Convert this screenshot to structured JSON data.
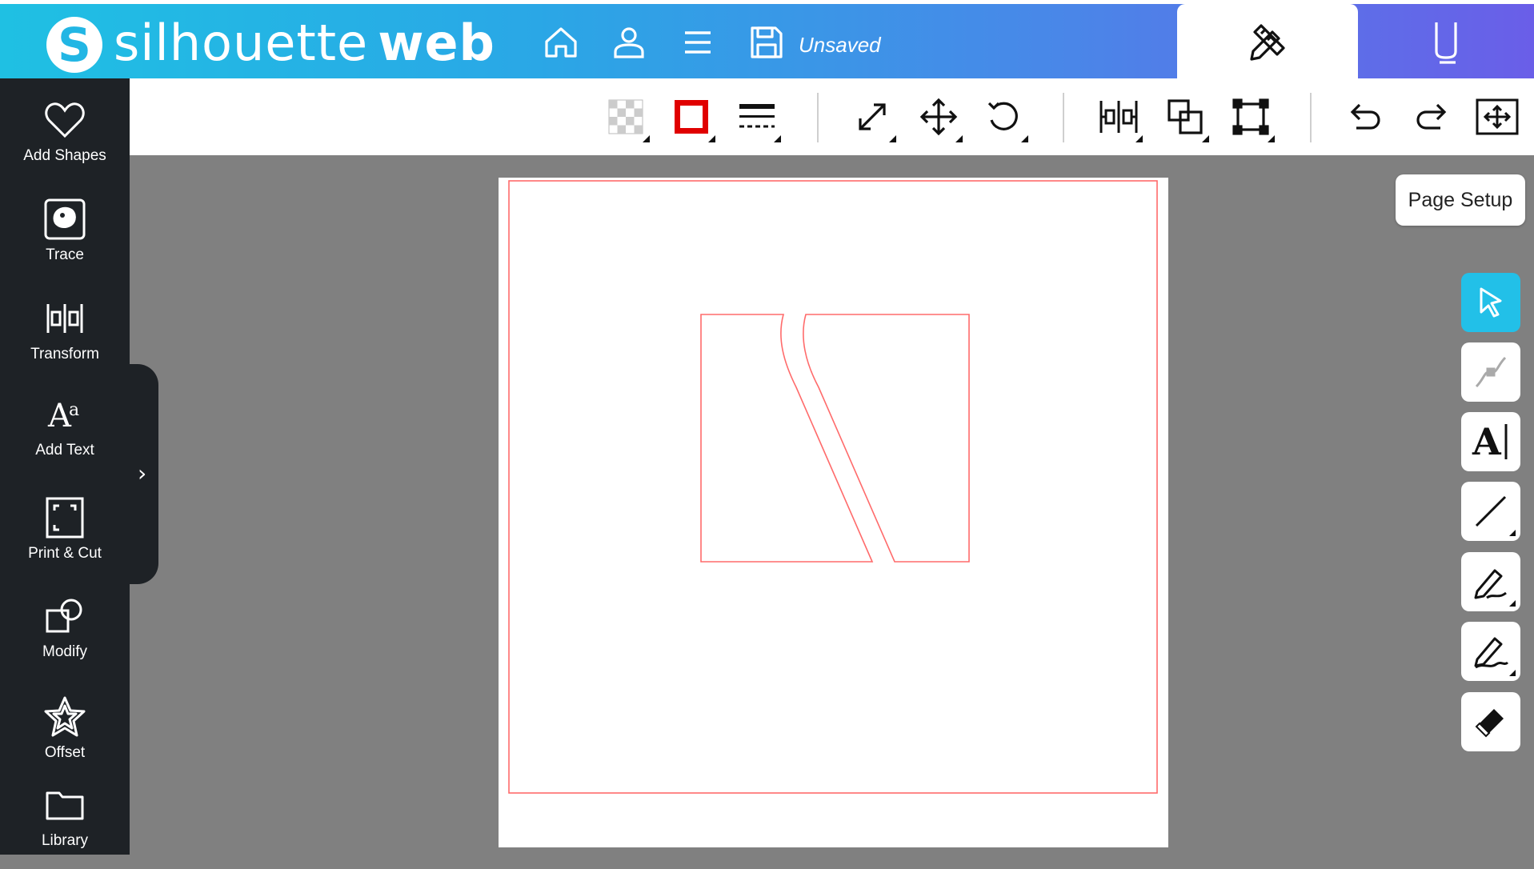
{
  "header": {
    "logo_letter": "S",
    "logo_light": "silhouette",
    "logo_bold": "web",
    "save_status": "Unsaved",
    "icons": [
      "home-icon",
      "user-icon",
      "menu-icon",
      "save-icon"
    ],
    "tabs": [
      {
        "name": "design-tab",
        "icon": "pencil-ruler-icon",
        "active": true
      },
      {
        "name": "send-tab",
        "icon": "blade-icon",
        "active": false
      }
    ]
  },
  "sidebar": {
    "items": [
      {
        "label": "Add Shapes",
        "icon": "heart-icon"
      },
      {
        "label": "Trace",
        "icon": "trace-icon"
      },
      {
        "label": "Transform",
        "icon": "transform-icon"
      },
      {
        "label": "Add Text",
        "icon": "text-icon"
      },
      {
        "label": "Print & Cut",
        "icon": "print-cut-icon"
      },
      {
        "label": "Modify",
        "icon": "modify-icon"
      },
      {
        "label": "Offset",
        "icon": "star-icon"
      },
      {
        "label": "Library",
        "icon": "folder-icon"
      }
    ],
    "expand_glyph": "›"
  },
  "toolbar": {
    "buttons": [
      {
        "name": "fill-color-button",
        "icon": "fill-transparent-icon"
      },
      {
        "name": "line-color-button",
        "icon": "line-color-icon",
        "color": "#e00000"
      },
      {
        "name": "line-style-button",
        "icon": "line-style-icon"
      },
      {
        "name": "scale-button",
        "icon": "scale-icon"
      },
      {
        "name": "move-button",
        "icon": "move-icon"
      },
      {
        "name": "rotate-button",
        "icon": "rotate-icon"
      },
      {
        "name": "align-button",
        "icon": "align-icon"
      },
      {
        "name": "arrange-button",
        "icon": "arrange-icon"
      },
      {
        "name": "group-button",
        "icon": "group-icon"
      },
      {
        "name": "undo-button",
        "icon": "undo-icon"
      },
      {
        "name": "redo-button",
        "icon": "redo-icon"
      },
      {
        "name": "fit-to-window-button",
        "icon": "fit-icon"
      }
    ]
  },
  "canvas": {
    "page_setup_label": "Page Setup",
    "cut_line_color": "#ff6b6b"
  },
  "right_tools": [
    {
      "name": "select-tool",
      "icon": "pointer-icon",
      "active": true
    },
    {
      "name": "point-edit-tool",
      "icon": "point-edit-icon",
      "active": false
    },
    {
      "name": "text-tool",
      "icon": "text-cursor-icon",
      "active": false,
      "glyph": "A"
    },
    {
      "name": "line-tool",
      "icon": "line-icon",
      "active": false
    },
    {
      "name": "draw-tool",
      "icon": "pen-icon",
      "active": false
    },
    {
      "name": "freehand-tool",
      "icon": "freehand-icon",
      "active": false
    },
    {
      "name": "eraser-tool",
      "icon": "eraser-icon",
      "active": false
    }
  ],
  "colors": {
    "accent": "#22c0e8",
    "sidebar_bg": "#1e2226",
    "workspace_bg": "#808080"
  }
}
